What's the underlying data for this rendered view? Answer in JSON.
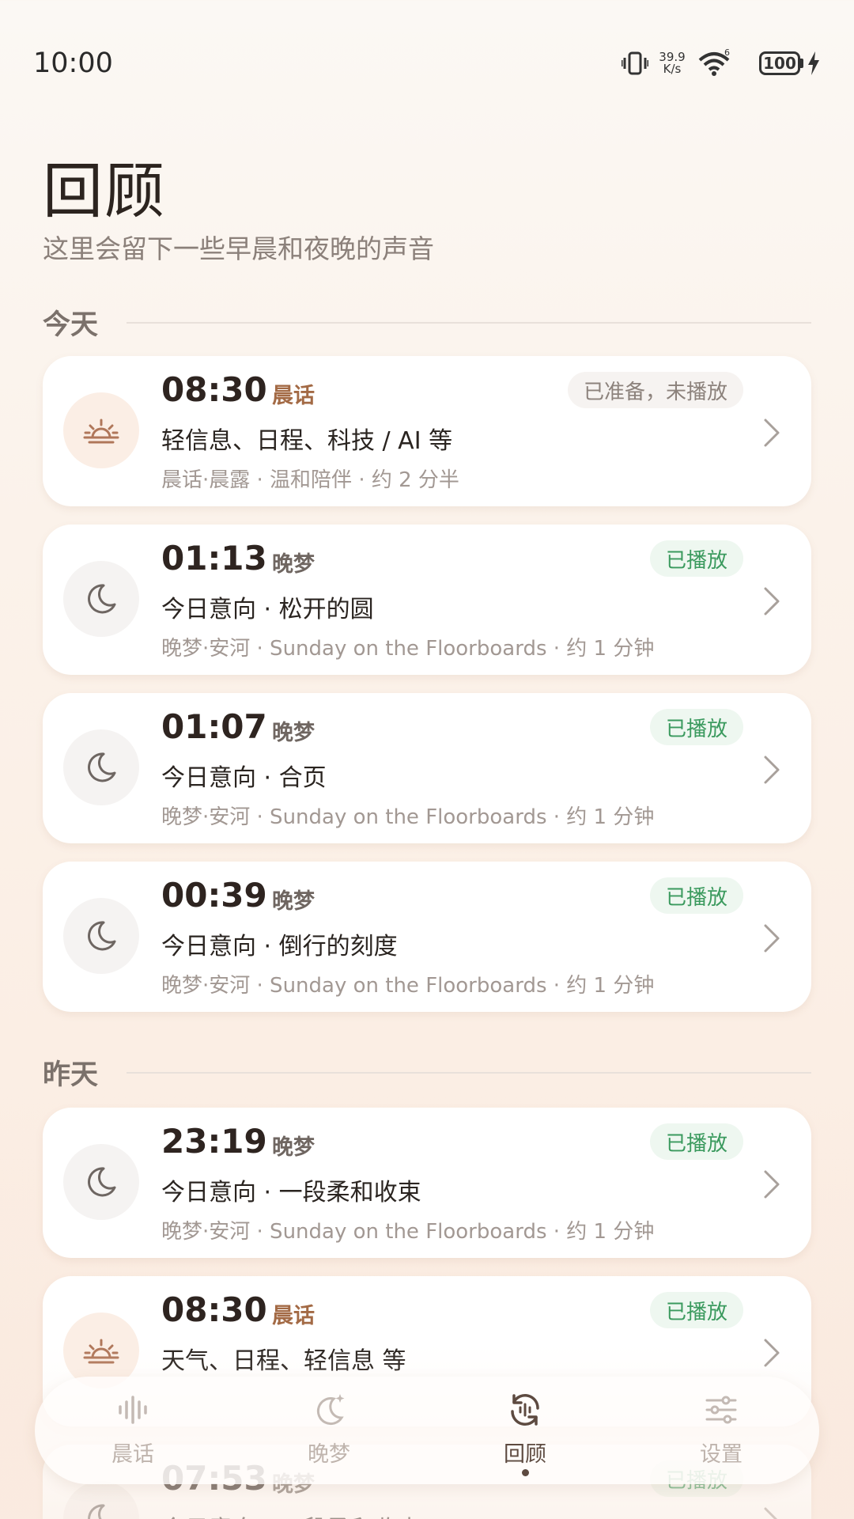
{
  "status_bar": {
    "time": "10:00",
    "net_speed_value": "39.9",
    "net_speed_unit": "K/s",
    "wifi_badge": "6",
    "battery": "100"
  },
  "header": {
    "title": "回顾",
    "subtitle": "这里会留下一些早晨和夜晚的声音"
  },
  "sections": [
    {
      "label": "今天"
    },
    {
      "label": "昨天"
    }
  ],
  "cards": [
    {
      "time": "08:30",
      "tag": "晨话",
      "kind": "morning",
      "status": "已准备，未播放",
      "status_kind": "ready",
      "title": "轻信息、日程、科技 / AI 等",
      "meta": "晨话·晨露 · 温和陪伴 · 约 2 分半"
    },
    {
      "time": "01:13",
      "tag": "晚梦",
      "kind": "night",
      "status": "已播放",
      "status_kind": "played",
      "title": "今日意向 · 松开的圆",
      "meta": "晚梦·安河 · Sunday on the Floorboards · 约 1 分钟"
    },
    {
      "time": "01:07",
      "tag": "晚梦",
      "kind": "night",
      "status": "已播放",
      "status_kind": "played",
      "title": "今日意向 · 合页",
      "meta": "晚梦·安河 · Sunday on the Floorboards · 约 1 分钟"
    },
    {
      "time": "00:39",
      "tag": "晚梦",
      "kind": "night",
      "status": "已播放",
      "status_kind": "played",
      "title": "今日意向 · 倒行的刻度",
      "meta": "晚梦·安河 · Sunday on the Floorboards · 约 1 分钟"
    },
    {
      "time": "23:19",
      "tag": "晚梦",
      "kind": "night",
      "status": "已播放",
      "status_kind": "played",
      "title": "今日意向 · 一段柔和收束",
      "meta": "晚梦·安河 · Sunday on the Floorboards · 约 1 分钟"
    },
    {
      "time": "08:30",
      "tag": "晨话",
      "kind": "morning",
      "status": "已播放",
      "status_kind": "played",
      "title": "天气、日程、轻信息 等",
      "meta": ""
    },
    {
      "time": "07:53",
      "tag": "晚梦",
      "kind": "night",
      "status": "已播放",
      "status_kind": "played",
      "title": "今日意向 · 一段柔和收束",
      "meta": ""
    }
  ],
  "nav": {
    "items": [
      {
        "label": "晨话",
        "icon": "waveform-icon"
      },
      {
        "label": "晚梦",
        "icon": "moon-star-icon"
      },
      {
        "label": "回顾",
        "icon": "replay-icon"
      },
      {
        "label": "设置",
        "icon": "sliders-icon"
      }
    ],
    "active_index": 2
  },
  "colors": {
    "accent_morning": "#a36a45",
    "played_green": "#3b9a5e",
    "background": "#fbf2ea"
  }
}
